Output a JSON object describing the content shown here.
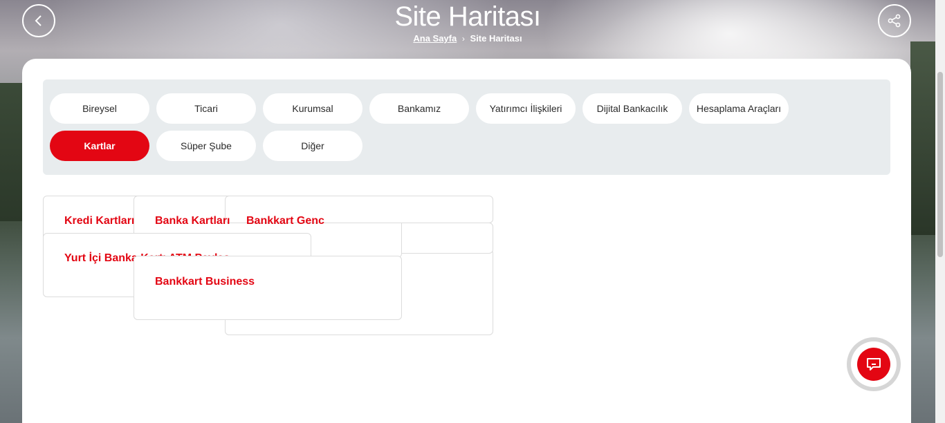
{
  "header": {
    "title": "Site Haritası",
    "breadcrumb": {
      "home": "Ana Sayfa",
      "current": "Site Haritası"
    },
    "back_icon": "chevron-left-icon",
    "share_icon": "share-icon"
  },
  "tabs": [
    {
      "label": "Bireysel",
      "active": false
    },
    {
      "label": "Ticari",
      "active": false
    },
    {
      "label": "Kurumsal",
      "active": false
    },
    {
      "label": "Bankamız",
      "active": false
    },
    {
      "label": "Yatırımcı İlişkileri",
      "active": false
    },
    {
      "label": "Dijital Bankacılık",
      "active": false
    },
    {
      "label": "Hesaplama Araçları",
      "active": false
    },
    {
      "label": "Kartlar",
      "active": true
    },
    {
      "label": "Süper Şube",
      "active": false
    },
    {
      "label": "Diğer",
      "active": false
    }
  ],
  "links": [
    "Kredi Kartları",
    "Banka Kartları",
    "Bankkart Genç",
    "Yurt İçi Banka Kartı ATM Paylaşımı",
    "Bankkart Business"
  ],
  "colors": {
    "accent": "#e30613",
    "panel": "#e8ecee"
  },
  "chat_icon": "chat-icon"
}
